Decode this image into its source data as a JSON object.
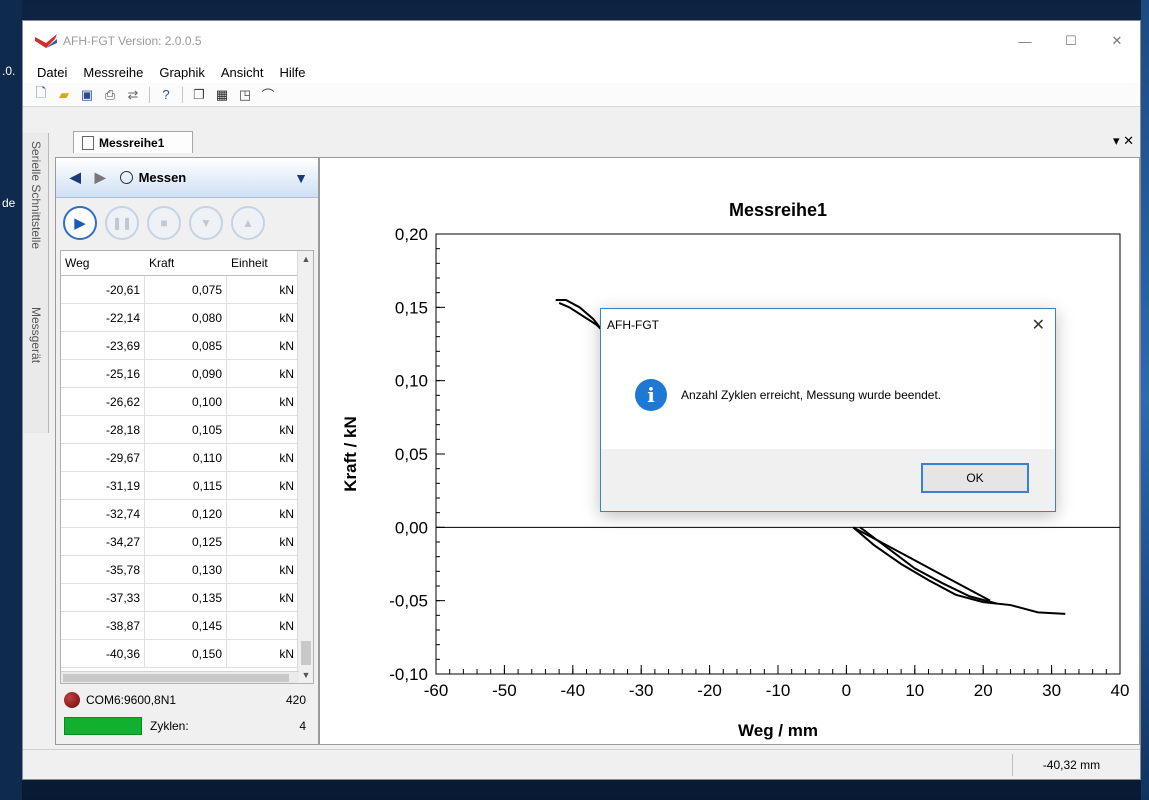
{
  "desktop": {
    "fragments": [
      ".0.",
      "de"
    ]
  },
  "window": {
    "title": "AFH-FGT  Version: 2.0.0.5",
    "controls": {
      "minimize": "—",
      "maximize": "☐",
      "close": "✕"
    }
  },
  "menu": {
    "items": [
      "Datei",
      "Messreihe",
      "Graphik",
      "Ansicht",
      "Hilfe"
    ]
  },
  "toolbar": {
    "icons": [
      "new-icon",
      "open-icon",
      "save-icon",
      "print-icon",
      "connect-icon",
      "help-icon",
      "copy-icon",
      "table-icon",
      "window-icon",
      "chart-icon"
    ]
  },
  "tabs": {
    "active": "Messreihe1",
    "controls": "▾ ✕"
  },
  "sidetabs": [
    "Serielle Schnittstelle",
    "Messgerät"
  ],
  "panel": {
    "nav_label": "Messen",
    "grid": {
      "headers": [
        "Weg",
        "Kraft",
        "Einheit"
      ],
      "rows": [
        [
          "-20,61",
          "0,075",
          "kN"
        ],
        [
          "-22,14",
          "0,080",
          "kN"
        ],
        [
          "-23,69",
          "0,085",
          "kN"
        ],
        [
          "-25,16",
          "0,090",
          "kN"
        ],
        [
          "-26,62",
          "0,100",
          "kN"
        ],
        [
          "-28,18",
          "0,105",
          "kN"
        ],
        [
          "-29,67",
          "0,110",
          "kN"
        ],
        [
          "-31,19",
          "0,115",
          "kN"
        ],
        [
          "-32,74",
          "0,120",
          "kN"
        ],
        [
          "-34,27",
          "0,125",
          "kN"
        ],
        [
          "-35,78",
          "0,130",
          "kN"
        ],
        [
          "-37,33",
          "0,135",
          "kN"
        ],
        [
          "-38,87",
          "0,145",
          "kN"
        ],
        [
          "-40,36",
          "0,150",
          "kN"
        ]
      ]
    },
    "com": {
      "label": "COM6:9600,8N1",
      "count": "420"
    },
    "zyklen": {
      "label": "Zyklen:",
      "count": "4"
    }
  },
  "status": {
    "position": "-40,32 mm"
  },
  "dialog": {
    "title": "AFH-FGT",
    "message": "Anzahl Zyklen erreicht, Messung wurde beendet.",
    "ok": "OK"
  },
  "chart_data": {
    "type": "line",
    "title": "Messreihe1",
    "xlabel": "Weg / mm",
    "ylabel": "Kraft / kN",
    "xlim": [
      -60,
      40
    ],
    "ylim": [
      -0.1,
      0.2
    ],
    "xticks": [
      "-60",
      "-50",
      "-40",
      "-30",
      "-20",
      "-10",
      "0",
      "10",
      "20",
      "30",
      "40"
    ],
    "yticks": [
      "0,20",
      "0,15",
      "0,10",
      "0,05",
      "0,00",
      "-0,05",
      "-0,10"
    ],
    "grid": false,
    "series": [
      {
        "x": [
          -42.5,
          -41,
          -39,
          -37,
          -36,
          -35
        ],
        "y": [
          0.155,
          0.155,
          0.15,
          0.142,
          0.136,
          0.132
        ]
      },
      {
        "x": [
          -42,
          -40.5,
          -38.5,
          -36.5,
          -35
        ],
        "y": [
          0.153,
          0.15,
          0.144,
          0.138,
          0.131
        ]
      },
      {
        "x": [
          1,
          4,
          8,
          12,
          16,
          20,
          24,
          28,
          32
        ],
        "y": [
          0.0,
          -0.012,
          -0.025,
          -0.036,
          -0.046,
          -0.051,
          -0.053,
          -0.058,
          -0.059
        ]
      },
      {
        "x": [
          1,
          5,
          9,
          13,
          17,
          21
        ],
        "y": [
          0.0,
          -0.01,
          -0.02,
          -0.03,
          -0.04,
          -0.05
        ]
      },
      {
        "x": [
          2,
          6,
          10,
          14,
          18,
          22
        ],
        "y": [
          0.0,
          -0.014,
          -0.028,
          -0.038,
          -0.047,
          -0.052
        ]
      }
    ]
  }
}
